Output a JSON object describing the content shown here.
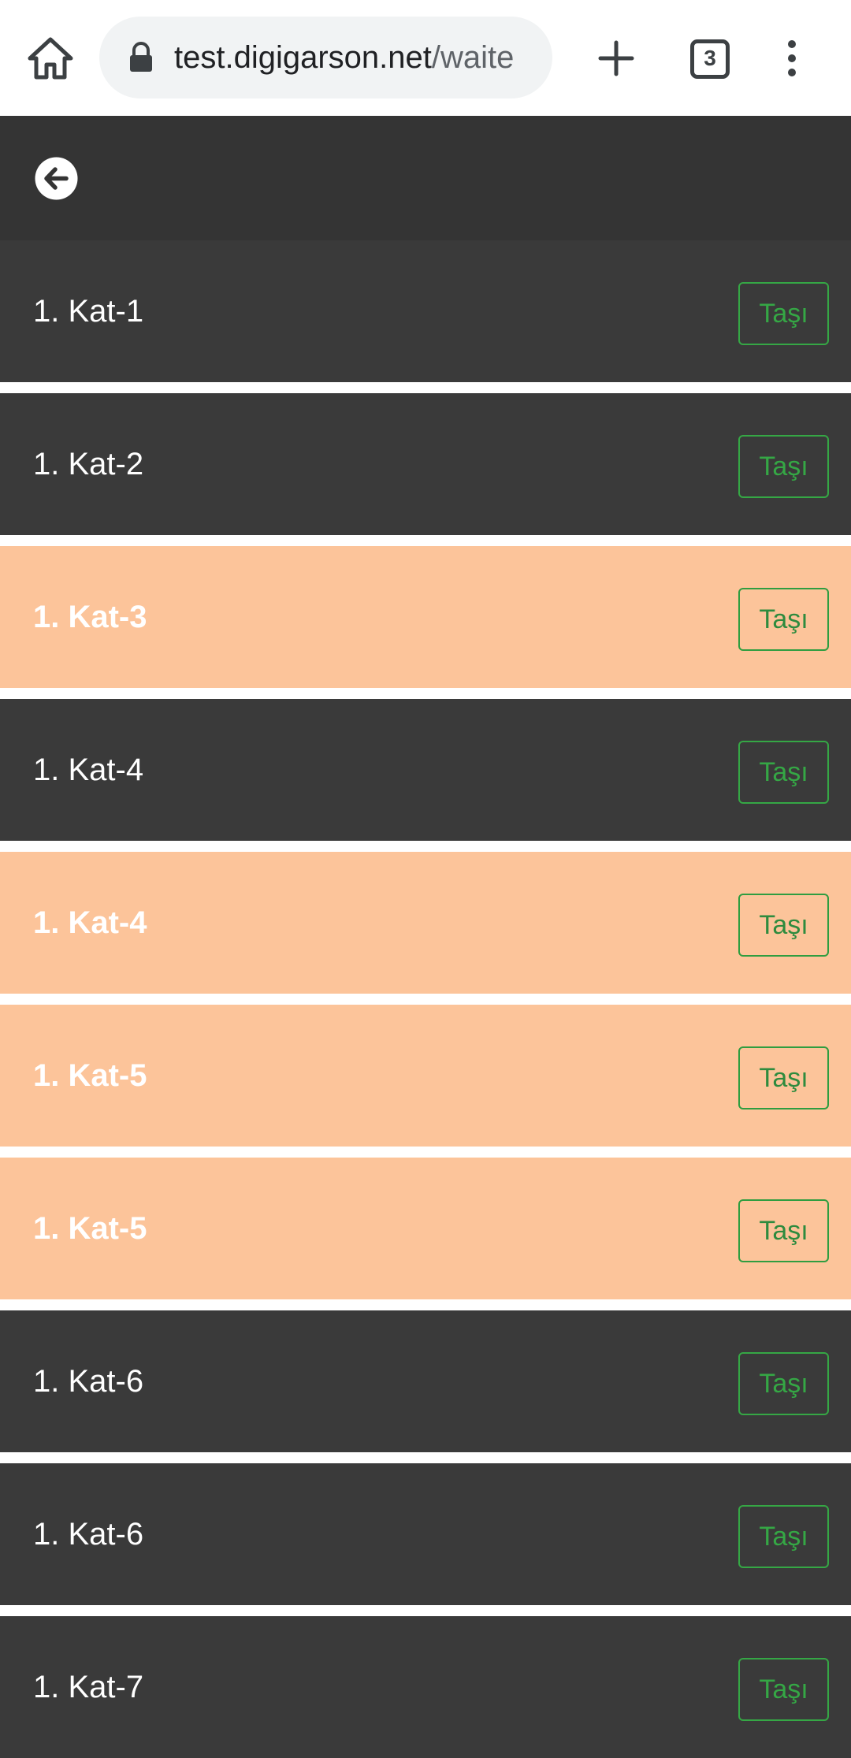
{
  "browser": {
    "url_host": "test.digigarson.net",
    "url_rest": "/waite",
    "tab_count": "3",
    "icons": [
      "home-icon",
      "lock-icon",
      "plus-icon",
      "tab-switcher-icon",
      "more-vert-icon"
    ]
  },
  "header": {
    "back_icon": "arrow-left-circle-icon"
  },
  "colors": {
    "header_bg": "#343434",
    "row_bg": "#3a3a3a",
    "row_highlight_bg": "#fcc49a",
    "button_accent": "#35a745"
  },
  "rows": [
    {
      "label": "1. Kat-1",
      "button": "Taşı",
      "highlight": false
    },
    {
      "label": "1. Kat-2",
      "button": "Taşı",
      "highlight": false
    },
    {
      "label": "1. Kat-3",
      "button": "Taşı",
      "highlight": true
    },
    {
      "label": "1. Kat-4",
      "button": "Taşı",
      "highlight": false
    },
    {
      "label": "1. Kat-4",
      "button": "Taşı",
      "highlight": true
    },
    {
      "label": "1. Kat-5",
      "button": "Taşı",
      "highlight": true
    },
    {
      "label": "1. Kat-5",
      "button": "Taşı",
      "highlight": true
    },
    {
      "label": "1. Kat-6",
      "button": "Taşı",
      "highlight": false
    },
    {
      "label": "1. Kat-6",
      "button": "Taşı",
      "highlight": false
    },
    {
      "label": "1. Kat-7",
      "button": "Taşı",
      "highlight": false
    }
  ]
}
